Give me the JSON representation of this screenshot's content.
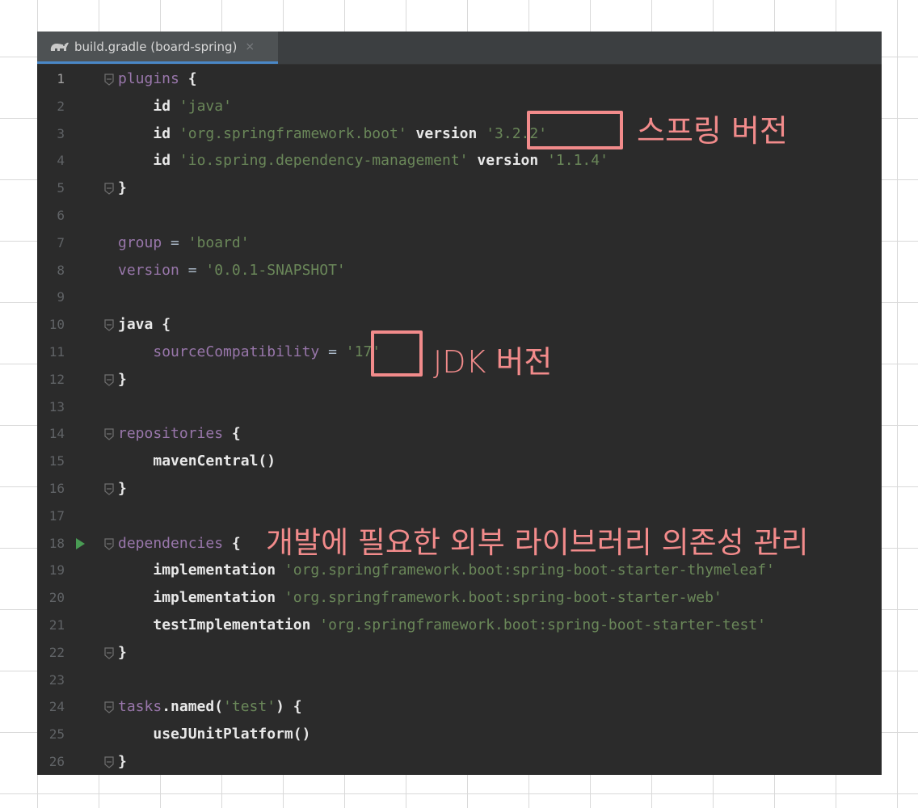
{
  "tab": {
    "title": "build.gradle (board-spring)",
    "close": "×",
    "icon": "gradle-elephant-icon"
  },
  "lines": [
    {
      "n": "1",
      "tokens": [
        {
          "t": "plugins",
          "c": "mt"
        },
        {
          "t": " ",
          "c": "plain"
        },
        {
          "t": "{",
          "c": "br"
        }
      ],
      "fold": true
    },
    {
      "n": "2",
      "tokens": [
        {
          "t": "    ",
          "c": "plain"
        },
        {
          "t": "id",
          "c": "bold"
        },
        {
          "t": " ",
          "c": "plain"
        },
        {
          "t": "'java'",
          "c": "str"
        }
      ]
    },
    {
      "n": "3",
      "tokens": [
        {
          "t": "    ",
          "c": "plain"
        },
        {
          "t": "id",
          "c": "bold"
        },
        {
          "t": " ",
          "c": "plain"
        },
        {
          "t": "'org.springframework.boot'",
          "c": "str"
        },
        {
          "t": " ",
          "c": "plain"
        },
        {
          "t": "version",
          "c": "bold"
        },
        {
          "t": " ",
          "c": "plain"
        },
        {
          "t": "'3.2.2'",
          "c": "str"
        }
      ]
    },
    {
      "n": "4",
      "tokens": [
        {
          "t": "    ",
          "c": "plain"
        },
        {
          "t": "id",
          "c": "bold"
        },
        {
          "t": " ",
          "c": "plain"
        },
        {
          "t": "'io.spring.dependency-management'",
          "c": "str"
        },
        {
          "t": " ",
          "c": "plain"
        },
        {
          "t": "version",
          "c": "bold"
        },
        {
          "t": " ",
          "c": "plain"
        },
        {
          "t": "'1.1.4'",
          "c": "str"
        }
      ]
    },
    {
      "n": "5",
      "tokens": [
        {
          "t": "}",
          "c": "br"
        }
      ],
      "fold": true
    },
    {
      "n": "6",
      "tokens": []
    },
    {
      "n": "7",
      "tokens": [
        {
          "t": "group",
          "c": "mt"
        },
        {
          "t": " = ",
          "c": "plain"
        },
        {
          "t": "'board'",
          "c": "str"
        }
      ]
    },
    {
      "n": "8",
      "tokens": [
        {
          "t": "version",
          "c": "mt"
        },
        {
          "t": " = ",
          "c": "plain"
        },
        {
          "t": "'0.0.1-SNAPSHOT'",
          "c": "str"
        }
      ]
    },
    {
      "n": "9",
      "tokens": []
    },
    {
      "n": "10",
      "tokens": [
        {
          "t": "java",
          "c": "bold"
        },
        {
          "t": " ",
          "c": "plain"
        },
        {
          "t": "{",
          "c": "br"
        }
      ],
      "fold": true
    },
    {
      "n": "11",
      "tokens": [
        {
          "t": "    ",
          "c": "plain"
        },
        {
          "t": "sourceCompatibility",
          "c": "mt"
        },
        {
          "t": " = ",
          "c": "plain"
        },
        {
          "t": "'17'",
          "c": "str"
        }
      ]
    },
    {
      "n": "12",
      "tokens": [
        {
          "t": "}",
          "c": "br"
        }
      ],
      "fold": true
    },
    {
      "n": "13",
      "tokens": []
    },
    {
      "n": "14",
      "tokens": [
        {
          "t": "repositories",
          "c": "mt"
        },
        {
          "t": " ",
          "c": "plain"
        },
        {
          "t": "{",
          "c": "br"
        }
      ],
      "fold": true
    },
    {
      "n": "15",
      "tokens": [
        {
          "t": "    ",
          "c": "plain"
        },
        {
          "t": "mavenCentral()",
          "c": "bold"
        }
      ]
    },
    {
      "n": "16",
      "tokens": [
        {
          "t": "}",
          "c": "br"
        }
      ],
      "fold": true
    },
    {
      "n": "17",
      "tokens": []
    },
    {
      "n": "18",
      "tokens": [
        {
          "t": "dependencies",
          "c": "mt"
        },
        {
          "t": " ",
          "c": "plain"
        },
        {
          "t": "{",
          "c": "br"
        }
      ],
      "fold": true,
      "run": true
    },
    {
      "n": "19",
      "tokens": [
        {
          "t": "    ",
          "c": "plain"
        },
        {
          "t": "implementation",
          "c": "bold"
        },
        {
          "t": " ",
          "c": "plain"
        },
        {
          "t": "'org.springframework.boot:spring-boot-starter-thymeleaf'",
          "c": "str"
        }
      ]
    },
    {
      "n": "20",
      "tokens": [
        {
          "t": "    ",
          "c": "plain"
        },
        {
          "t": "implementation",
          "c": "bold"
        },
        {
          "t": " ",
          "c": "plain"
        },
        {
          "t": "'org.springframework.boot:spring-boot-starter-web'",
          "c": "str"
        }
      ]
    },
    {
      "n": "21",
      "tokens": [
        {
          "t": "    ",
          "c": "plain"
        },
        {
          "t": "testImplementation",
          "c": "bold"
        },
        {
          "t": " ",
          "c": "plain"
        },
        {
          "t": "'org.springframework.boot:spring-boot-starter-test'",
          "c": "str"
        }
      ]
    },
    {
      "n": "22",
      "tokens": [
        {
          "t": "}",
          "c": "br"
        }
      ],
      "fold": true
    },
    {
      "n": "23",
      "tokens": []
    },
    {
      "n": "24",
      "tokens": [
        {
          "t": "tasks",
          "c": "mt"
        },
        {
          "t": ".named(",
          "c": "bold"
        },
        {
          "t": "'test'",
          "c": "str"
        },
        {
          "t": ") ",
          "c": "bold"
        },
        {
          "t": "{",
          "c": "br"
        }
      ],
      "fold": true
    },
    {
      "n": "25",
      "tokens": [
        {
          "t": "    ",
          "c": "plain"
        },
        {
          "t": "useJUnitPlatform()",
          "c": "bold"
        }
      ]
    },
    {
      "n": "26",
      "tokens": [
        {
          "t": "}",
          "c": "br"
        }
      ],
      "fold": true
    }
  ],
  "annotations": {
    "spring_version": "스프링 버전",
    "jdk_version": "JDK 버전",
    "dependencies_note": "개발에 필요한 외부 라이브러리 의존성 관리"
  },
  "colors": {
    "editor_bg": "#2b2b2b",
    "string": "#6a8759",
    "method": "#9876aa",
    "annotation": "#f28b8b",
    "run_icon": "#499c54"
  }
}
